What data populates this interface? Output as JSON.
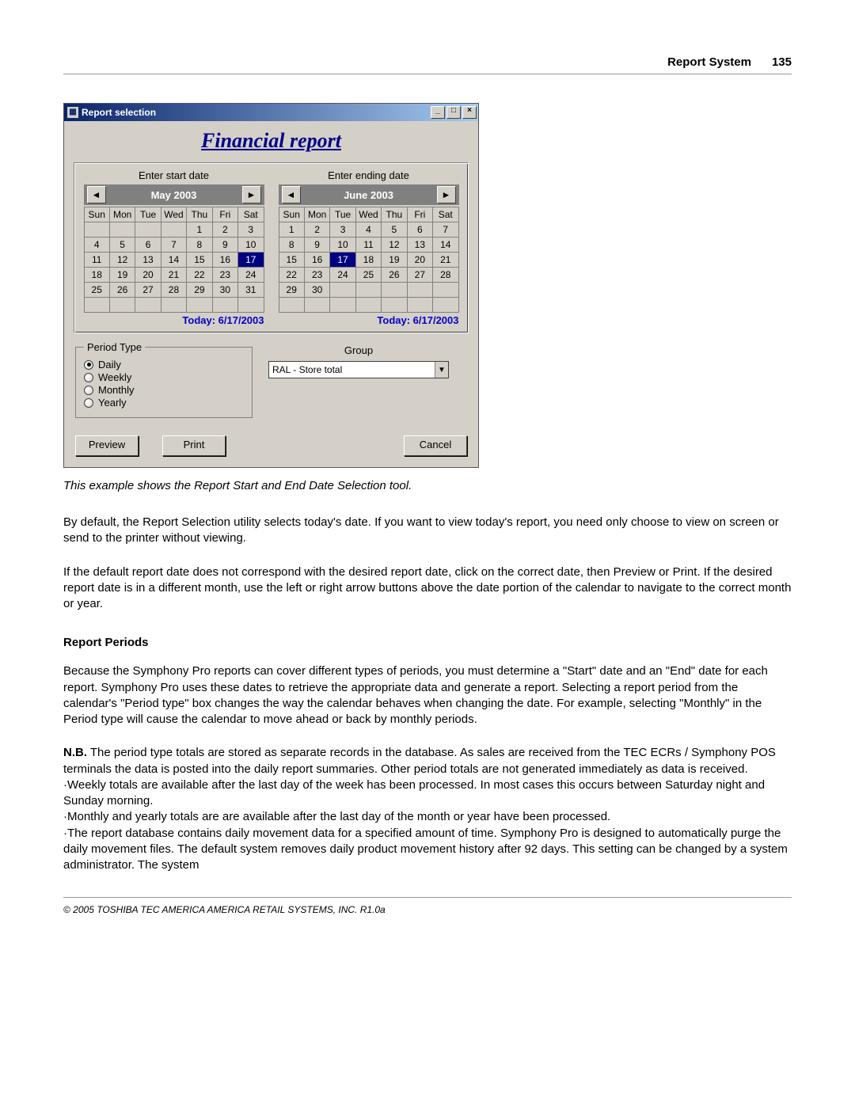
{
  "header": {
    "chapter": "Report System",
    "page_number": "135"
  },
  "dialog": {
    "window_title": "Report selection",
    "heading": "Financial report",
    "start_label": "Enter start date",
    "end_label": "Enter ending date",
    "start_cal": {
      "month": "May  2003",
      "dow": [
        "Sun",
        "Mon",
        "Tue",
        "Wed",
        "Thu",
        "Fri",
        "Sat"
      ],
      "weeks": [
        [
          "",
          "",
          "",
          "",
          "1",
          "2",
          "3"
        ],
        [
          "4",
          "5",
          "6",
          "7",
          "8",
          "9",
          "10"
        ],
        [
          "11",
          "12",
          "13",
          "14",
          "15",
          "16",
          "17"
        ],
        [
          "18",
          "19",
          "20",
          "21",
          "22",
          "23",
          "24"
        ],
        [
          "25",
          "26",
          "27",
          "28",
          "29",
          "30",
          "31"
        ],
        [
          "",
          "",
          "",
          "",
          "",
          "",
          ""
        ]
      ],
      "selected": "17",
      "today": "Today: 6/17/2003"
    },
    "end_cal": {
      "month": "June  2003",
      "dow": [
        "Sun",
        "Mon",
        "Tue",
        "Wed",
        "Thu",
        "Fri",
        "Sat"
      ],
      "weeks": [
        [
          "1",
          "2",
          "3",
          "4",
          "5",
          "6",
          "7"
        ],
        [
          "8",
          "9",
          "10",
          "11",
          "12",
          "13",
          "14"
        ],
        [
          "15",
          "16",
          "17",
          "18",
          "19",
          "20",
          "21"
        ],
        [
          "22",
          "23",
          "24",
          "25",
          "26",
          "27",
          "28"
        ],
        [
          "29",
          "30",
          "",
          "",
          "",
          "",
          ""
        ],
        [
          "",
          "",
          "",
          "",
          "",
          "",
          ""
        ]
      ],
      "selected": "17",
      "today": "Today: 6/17/2003"
    },
    "period_legend": "Period Type",
    "period_options": [
      "Daily",
      "Weekly",
      "Monthly",
      "Yearly"
    ],
    "period_selected": "Daily",
    "group_label": "Group",
    "group_value": "RAL - Store total",
    "preview": "Preview",
    "print": "Print",
    "cancel": "Cancel"
  },
  "caption": "This example shows the Report Start and End Date Selection tool.",
  "para1": " By default, the Report Selection utility selects today's date. If you want to view today's report, you need only choose to view on screen or send to the printer without viewing.",
  "para2": " If the default report date does not correspond with the desired report date, click on the correct date, then Preview or Print. If the desired report date is in a different month, use the left or right arrow buttons above the date portion of the calendar to navigate to the correct month or year.",
  "subhead": "Report Periods",
  "para3": " Because the Symphony Pro reports can cover different types of periods, you must determine a \"Start\" date and an \"End\" date for each report. Symphony Pro uses these dates to retrieve the appropriate data and generate a report. Selecting a report period from the calendar's \"Period type\" box changes the way the calendar behaves when changing the date. For example, selecting \"Monthly\" in the Period type will cause the calendar to move ahead or back by monthly periods.",
  "nb": {
    "lead": "N.B.",
    "l1": "  The period type totals are stored as separate records in the database. As sales are received from the TEC ECRs / Symphony POS terminals the data is posted into the daily report summaries. Other period totals are not generated immediately as data is received.",
    "l2": "·Weekly totals are available after the last day of the week has been processed. In most cases this occurs between Saturday night and Sunday morning.",
    "l3": "·Monthly and yearly totals are are available after the last day of the month or year have been processed.",
    "l4": "·The report database contains daily movement data for a specified amount of time. Symphony Pro is designed to automatically purge the daily movement files. The default system removes daily product movement history after 92 days. This setting can be changed by a system administrator. The system"
  },
  "footer": "© 2005 TOSHIBA TEC AMERICA AMERICA RETAIL SYSTEMS, INC.   R1.0a"
}
